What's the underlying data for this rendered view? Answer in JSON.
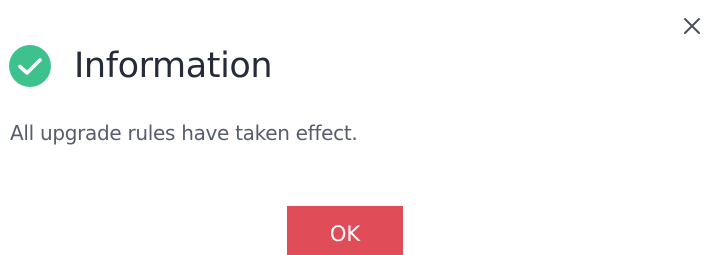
{
  "dialog": {
    "title": "Information",
    "message": "All upgrade rules have taken effect.",
    "ok_label": "OK",
    "close_icon": "close-icon",
    "status_icon": "check-circle-icon"
  },
  "colors": {
    "accent": "#e04c58",
    "success": "#3dc28d",
    "title_text": "#252b3a",
    "body_text": "#575d6c"
  }
}
